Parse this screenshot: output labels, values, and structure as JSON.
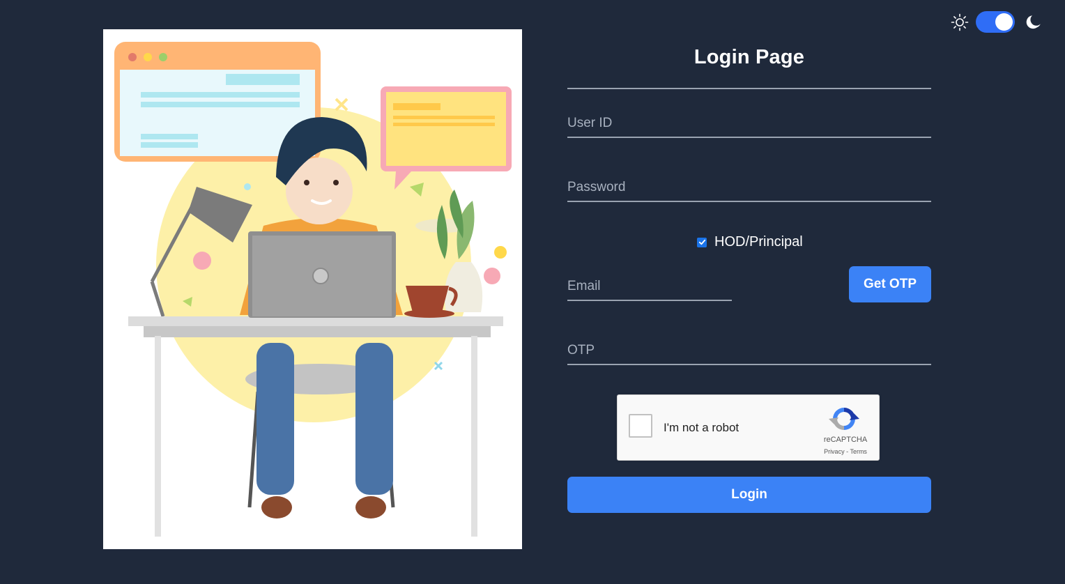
{
  "theme_toggle": {
    "state": "on",
    "accent_color": "#2f6df6"
  },
  "login": {
    "title": "Login Page",
    "user_id_placeholder": "User ID",
    "password_placeholder": "Password",
    "hod_checkbox": {
      "label": "HOD/Principal",
      "checked": true
    },
    "email_placeholder": "Email",
    "get_otp_label": "Get OTP",
    "otp_placeholder": "OTP",
    "submit_label": "Login"
  },
  "recaptcha": {
    "label": "I'm not a robot",
    "brand": "reCAPTCHA",
    "privacy": "Privacy",
    "separator": "-",
    "terms": "Terms"
  },
  "colors": {
    "background": "#1f293b",
    "primary_button": "#3b82f6",
    "text": "#ffffff",
    "field_line": "#9aa3b1"
  },
  "icons": [
    "sun-icon",
    "moon-icon",
    "recaptcha-logo-icon",
    "checkmark-icon"
  ]
}
